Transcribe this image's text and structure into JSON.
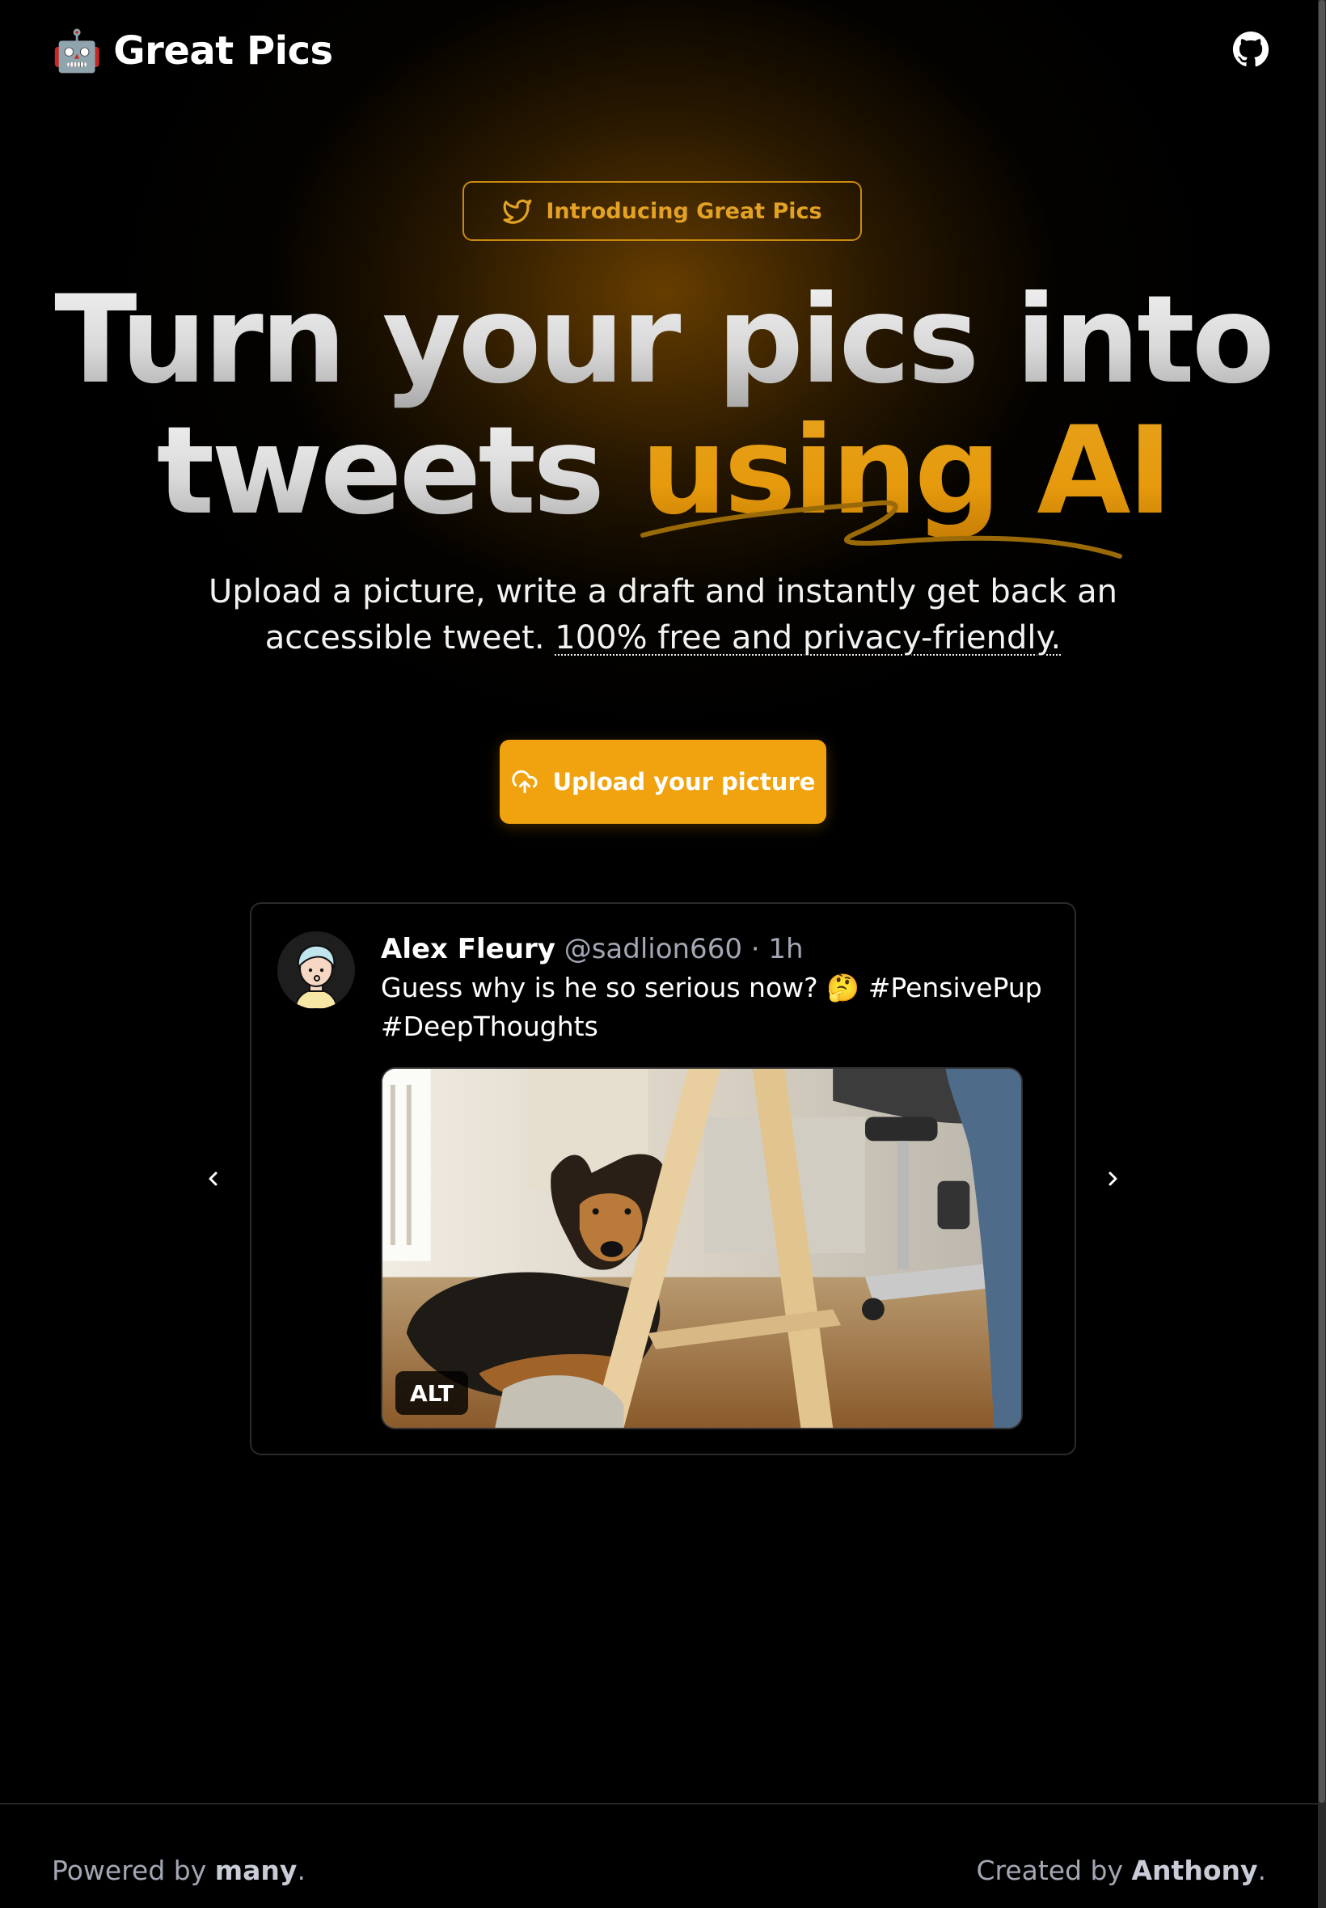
{
  "header": {
    "brand_emoji": "🤖",
    "brand_name": "Great Pics",
    "github_icon": "github-icon"
  },
  "hero": {
    "pill_icon": "twitter-bird-icon",
    "pill_label": "Introducing Great Pics",
    "headline_line1": "Turn your pics into",
    "headline_line2_white": "tweets ",
    "headline_line2_gold": "using AI",
    "subtitle_text": "Upload a picture, write a draft and instantly get back an accessible tweet. ",
    "subtitle_link": "100% free and privacy-friendly.",
    "cta_icon": "cloud-upload-icon",
    "cta_label": "Upload your picture"
  },
  "carousel": {
    "prev_icon": "chevron-left-icon",
    "next_icon": "chevron-right-icon",
    "tweet": {
      "name": "Alex Fleury",
      "handle": "@sadlion660",
      "separator": "·",
      "time": "1h",
      "text": "Guess why is he so serious now? 🤔 #PensivePup #DeepThoughts",
      "alt_badge": "ALT"
    }
  },
  "footer": {
    "powered_prefix": "Powered by ",
    "powered_name": "many",
    "powered_suffix": ".",
    "created_prefix": "Created by ",
    "created_name": "Anthony",
    "created_suffix": "."
  },
  "colors": {
    "accent": "#f0a30f",
    "pill_border": "#c98a12",
    "background": "#000000"
  }
}
